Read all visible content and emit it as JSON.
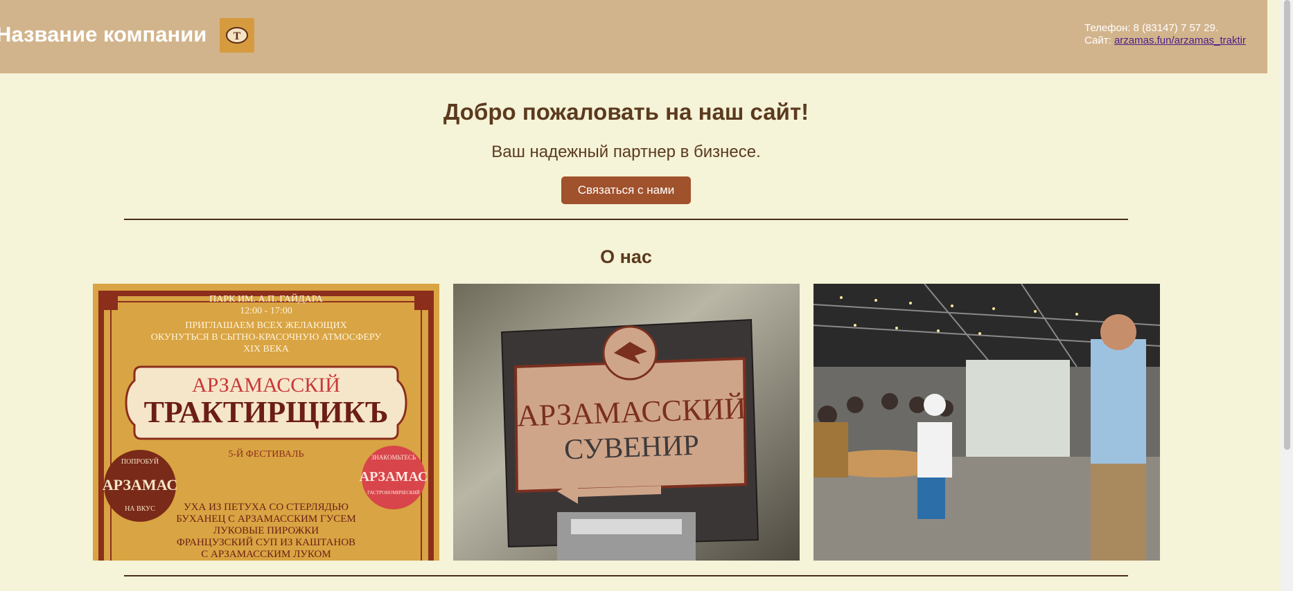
{
  "header": {
    "company_name": "Название компании",
    "logo_letter": "Т",
    "phone_text": "Телефон: 8 (83147) 7 57 29.",
    "site_label": "Сайт: ",
    "site_link": "arzamas.fun/arzamas_traktir"
  },
  "hero": {
    "title": "Добро пожаловать на наш сайт!",
    "tagline": "Ваш надежный партнер в бизнесе.",
    "button_label": "Связаться с нами"
  },
  "about": {
    "title": "О нас"
  },
  "poster": {
    "top_line": "ПАРК ИМ. А.П. ГАЙДАРА",
    "time": "12:00 - 17:00",
    "invite_1": "ПРИГЛАШАЕМ ВСЕХ ЖЕЛАЮЩИХ",
    "invite_2": "ОКУНУТЬСЯ В СЫТНО-КРАСОЧНУЮ АТМОСФЕРУ",
    "invite_3": "XIX ВЕКА",
    "brand_1": "АРЗАМАССКІЙ",
    "brand_2": "ТРАКТИРЩИКЪ",
    "festival": "5-Й ФЕСТИВАЛЬ",
    "menu_1": "УХА ИЗ ПЕТУХА СО СТЕРЛЯДЬЮ",
    "menu_2": "БУХАНЕЦ С АРЗАМАССКИМ ГУСЕМ",
    "menu_3": "ЛУКОВЫЕ ПИРОЖКИ",
    "menu_4": "ФРАНЦУЗСКИЙ СУП ИЗ КАШТАНОВ",
    "menu_5": "С АРЗАМАССКИМ ЛУКОМ",
    "badge_left_top": "ПОПРОБУЙ",
    "badge_left_main": "АРЗАМАС",
    "badge_left_bottom": "НА ВКУС",
    "badge_right_top": "ЗНАКОМЬТЕСЬ",
    "badge_right_main": "АРЗАМАС",
    "badge_right_bottom": "ГАСТРОНОМИЧЕСКИЙ"
  },
  "sign": {
    "line_1": "АРЗАМАССКИЙ",
    "line_2": "СУВЕНИР"
  },
  "colors": {
    "page_bg": "#f5f3d8",
    "header_bg": "#d2b48c",
    "accent": "#a0522d",
    "heading": "#5b3a1e"
  }
}
